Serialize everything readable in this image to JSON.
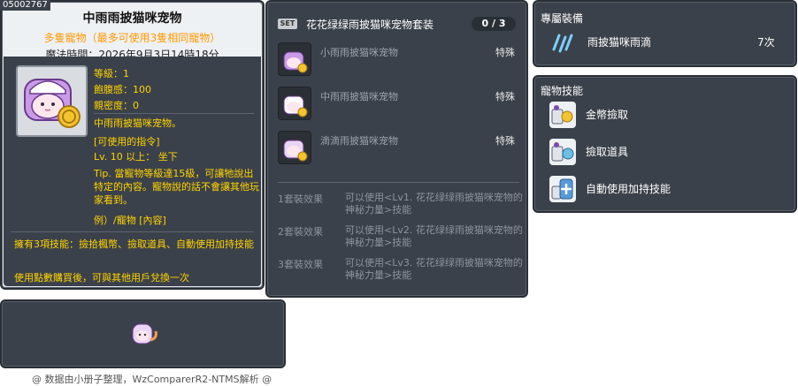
{
  "item_id": "05002767",
  "item": {
    "name": "中雨雨披猫咪宠物",
    "subtitle": "多隻寵物（最多可使用3隻相同寵物）",
    "magic_time": "魔法時間：2026年9月3日14時18分",
    "level": "等級：1",
    "fullness": "飽腹感：100",
    "intimacy": "親密度：0",
    "desc_line1": "中雨雨披猫咪宠物。",
    "desc_commands": "[可使用的指令]",
    "desc_cmd_line": "Lv. 10 以上： 坐下",
    "desc_tip": "Tip. 當寵物等級達15級，可讓牠說出特定的內容。寵物說的話不會讓其他玩家看到。",
    "desc_example": "例）/寵物 [內容]",
    "skills_note": "擁有3項技能：撿拾楓幣、撿取道具、自動使用加持技能",
    "exchange_note": "使用點數購買後，可與其他用戶兌換一次"
  },
  "set": {
    "badge": "SET",
    "title": "花花绿绿雨披猫咪宠物套装",
    "count": "0 / 3",
    "items": [
      {
        "name": "小雨雨披猫咪宠物",
        "type": "特殊"
      },
      {
        "name": "中雨雨披猫咪宠物",
        "type": "特殊"
      },
      {
        "name": "滴滴雨披猫咪宠物",
        "type": "特殊"
      }
    ],
    "effects": [
      {
        "label": "1套裝效果",
        "text": "可以使用<Lv1. 花花绿绿雨披猫咪宠物的神秘力量>技能"
      },
      {
        "label": "2套裝效果",
        "text": "可以使用<Lv2. 花花绿绿雨披猫咪宠物的神秘力量>技能"
      },
      {
        "label": "3套裝效果",
        "text": "可以使用<Lv3. 花花绿绿雨披猫咪宠物的神秘力量>技能"
      }
    ]
  },
  "exclusive": {
    "label": "專屬裝備",
    "name": "雨披猫咪雨滴",
    "count": "7次"
  },
  "pet_skills": {
    "label": "寵物技能",
    "items": [
      {
        "name": "金幣撿取",
        "icon": "coin-pickup-icon"
      },
      {
        "name": "撿取道具",
        "icon": "item-pickup-icon"
      },
      {
        "name": "自動使用加持技能",
        "icon": "auto-buff-icon"
      }
    ]
  },
  "footer": "@ 数据由小册子整理，WzComparerR2-NTMS解析 @",
  "colors": {
    "panel_bg": "#3b414a",
    "highlight_yellow": "#ffd400",
    "subtitle_orange": "#ff9900",
    "muted_text": "#8c949e"
  }
}
